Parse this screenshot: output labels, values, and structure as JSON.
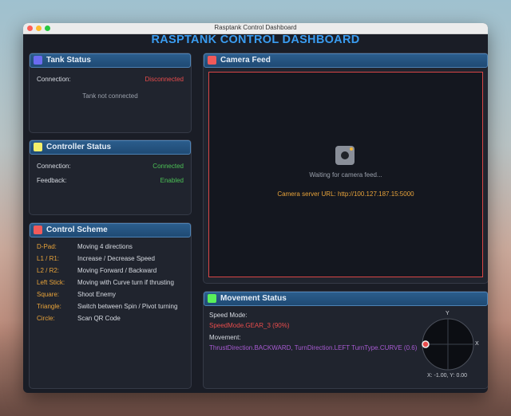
{
  "window": {
    "title": "Rasptank Control Dashboard"
  },
  "app": {
    "title": "RASPTANK CONTROL DASHBOARD"
  },
  "tank_status": {
    "title": "Tank Status",
    "icon_color": "#6b6bf0",
    "connection_label": "Connection:",
    "connection_value": "Disconnected",
    "message": "Tank not connected"
  },
  "controller_status": {
    "title": "Controller Status",
    "icon_color": "#f4f06a",
    "connection_label": "Connection:",
    "connection_value": "Connected",
    "feedback_label": "Feedback:",
    "feedback_value": "Enabled"
  },
  "control_scheme": {
    "title": "Control Scheme",
    "icon_color": "#f05a5a",
    "items": [
      {
        "key": "D-Pad:",
        "desc": "Moving 4 directions"
      },
      {
        "key": "L1 / R1:",
        "desc": "Increase / Decrease Speed"
      },
      {
        "key": "L2 / R2:",
        "desc": "Moving Forward / Backward"
      },
      {
        "key": "Left Stick:",
        "desc": "Moving with Curve turn if thrusting"
      },
      {
        "key": "Square:",
        "desc": "Shoot Enemy"
      },
      {
        "key": "Triangle:",
        "desc": "Switch between Spin / Pivot turning"
      },
      {
        "key": "Circle:",
        "desc": "Scan QR Code"
      }
    ]
  },
  "camera_feed": {
    "title": "Camera Feed",
    "icon_color": "#f05a5a",
    "waiting": "Waiting for camera feed...",
    "server_url": "Camera server URL: http://100.127.187.15:5000"
  },
  "movement_status": {
    "title": "Movement Status",
    "icon_color": "#5af05a",
    "speed_label": "Speed Mode:",
    "speed_value": "SpeedMode.GEAR_3 (90%)",
    "movement_label": "Movement:",
    "movement_value": "ThrustDirection.BACKWARD, TurnDirection.LEFT TurnType.CURVE (0.6)",
    "joystick": {
      "y_label": "Y",
      "x_label": "X",
      "readout": "X: -1.00, Y: 0.00",
      "x": -1.0,
      "y": 0.0
    }
  }
}
